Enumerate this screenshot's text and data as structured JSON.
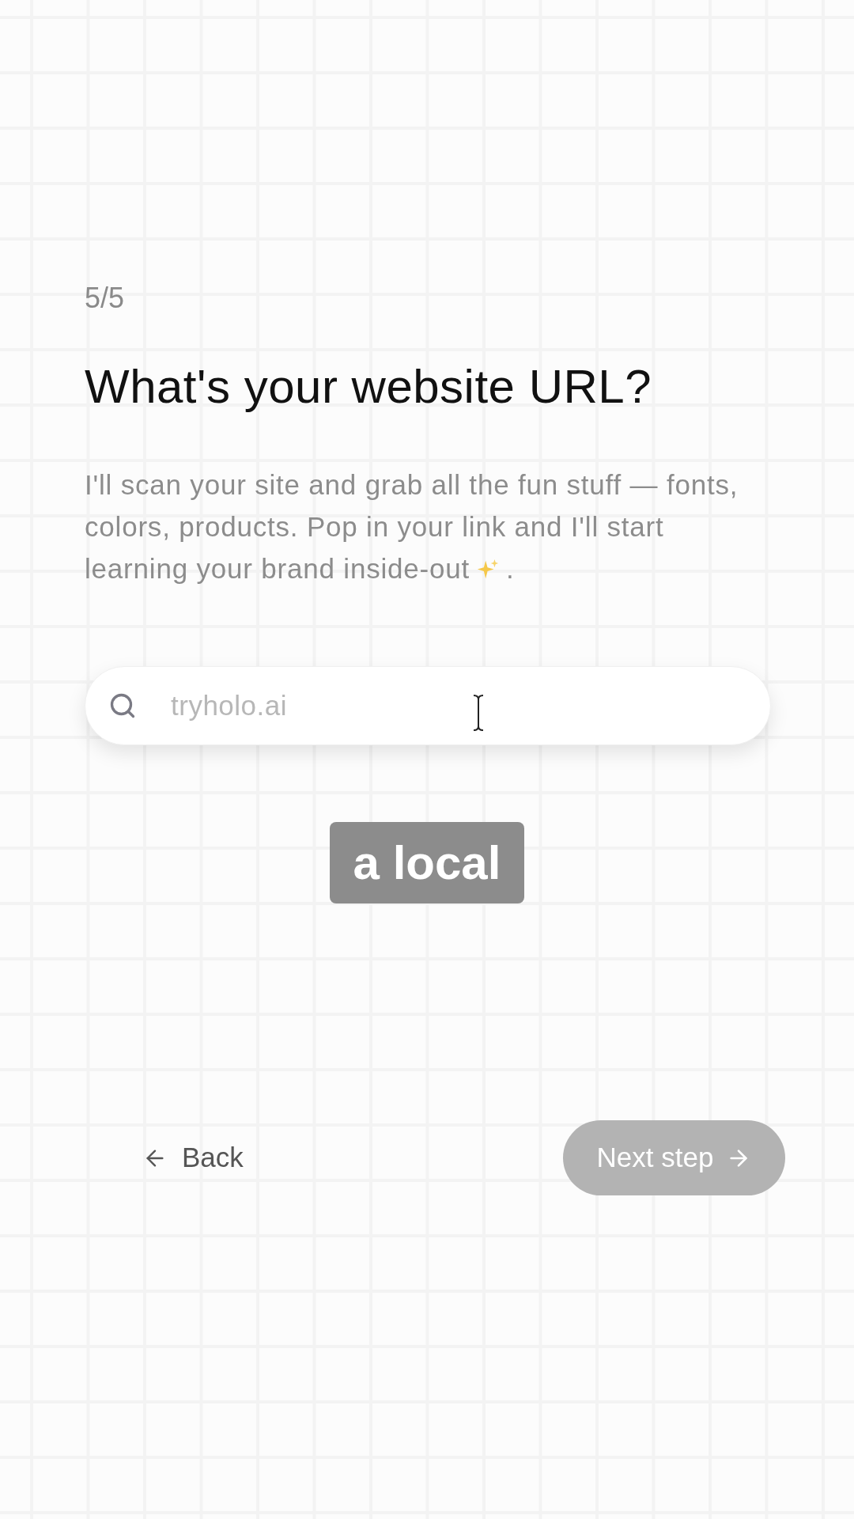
{
  "step": "5/5",
  "title": "What's your website URL?",
  "description": {
    "text": "I'll scan your site and grab all the fun stuff — fonts, colors, products. Pop in your link and I'll start learning your brand inside-out",
    "ending": "."
  },
  "url_field": {
    "placeholder": "tryholo.ai"
  },
  "caption": "a local",
  "back_button": {
    "label": "Back"
  },
  "next_button": {
    "label": "Next step",
    "disabled": true
  }
}
